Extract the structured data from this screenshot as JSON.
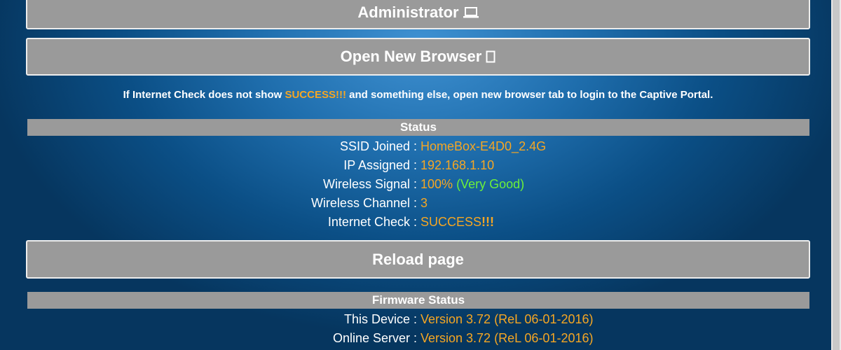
{
  "buttons": {
    "administrator": "Administrator",
    "open_browser": "Open New Browser",
    "reload": "Reload page"
  },
  "notice": {
    "before": "If Internet Check does not show ",
    "highlight": "SUCCESS!!!",
    "after": " and something else, open new browser tab to login to the Captive Portal."
  },
  "status": {
    "title": "Status",
    "rows": [
      {
        "label": "SSID Joined :",
        "value": "HomeBox-E4D0_2.4G"
      },
      {
        "label": "IP Assigned :",
        "value": "192.168.1.10"
      },
      {
        "label": "Wireless Signal :",
        "value": "100%",
        "extra": "(Very Good)"
      },
      {
        "label": "Wireless Channel :",
        "value": "3"
      },
      {
        "label": "Internet Check :",
        "value": "SUCCESS",
        "extra": "!!!"
      }
    ]
  },
  "firmware": {
    "title": "Firmware Status",
    "rows": [
      {
        "label": "This Device :",
        "value": "Version 3.72 (ReL 06-01-2016)"
      },
      {
        "label": "Online Server :",
        "value": "Version 3.72 (ReL 06-01-2016)"
      }
    ]
  },
  "icons": {
    "administrator": "laptop-icon",
    "open_browser": "new-window-icon"
  },
  "colors": {
    "accent": "#f5a623",
    "good": "#6cf03a",
    "button_bg": "#9a9a9a",
    "background": "#0b4f86"
  }
}
